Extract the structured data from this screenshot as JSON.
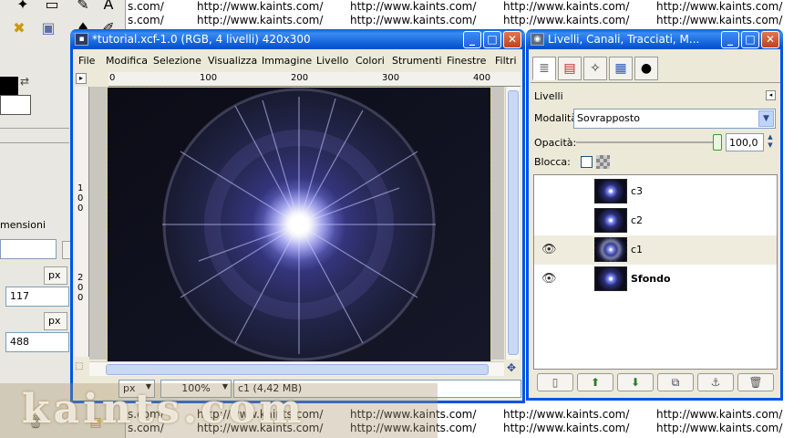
{
  "background": {
    "url_text": "http://www.kaints.com/",
    "partial_url_text": "s.com/"
  },
  "toolbox": {
    "dimension_label": "mensioni",
    "width_value": "117",
    "height_value": "488",
    "unit_1": "px",
    "unit_2": "px"
  },
  "watermark": {
    "text": "kaints.com"
  },
  "image_window": {
    "title": "*tutorial.xcf-1.0 (RGB, 4 livelli) 420x300",
    "menu": [
      "File",
      "Modifica",
      "Selezione",
      "Visualizza",
      "Immagine",
      "Livello",
      "Colori",
      "Strumenti",
      "Finestre",
      "Filtri"
    ],
    "hruler_labels": [
      "0",
      "100",
      "200",
      "300",
      "400"
    ],
    "vruler_labels": [
      "1",
      "0",
      "0",
      "2",
      "0",
      "0"
    ],
    "status": {
      "unit": "px",
      "zoom": "100%",
      "layer_info": "c1 (4,42 MB)"
    }
  },
  "layers_window": {
    "title": "Livelli, Canali, Tracciati, M...",
    "tabs": [
      "layers-tab",
      "channels-tab",
      "paths-tab",
      "colormap-tab",
      "histogram-tab"
    ],
    "panel_label": "Livelli",
    "mode_label": "Modalità:",
    "mode_value": "Sovrapposto",
    "opacity_label": "Opacità:",
    "opacity_value": "100,0",
    "opacity_level": 1.0,
    "lock_label": "Blocca:",
    "layers": [
      {
        "name": "c3",
        "visible": false,
        "selected": false,
        "bold": false
      },
      {
        "name": "c2",
        "visible": false,
        "selected": false,
        "bold": false
      },
      {
        "name": "c1",
        "visible": true,
        "selected": true,
        "bold": false
      },
      {
        "name": "Sfondo",
        "visible": true,
        "selected": false,
        "bold": true
      }
    ]
  },
  "colors": {
    "titlebar": "#0054e3",
    "window_bg": "#ece9d8",
    "canvas_bg": "#0e1020"
  }
}
